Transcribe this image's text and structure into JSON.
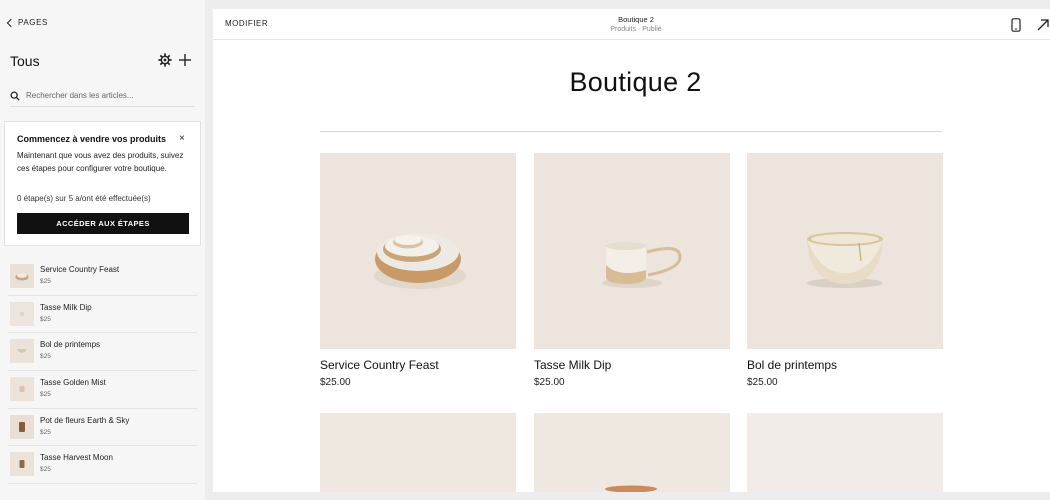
{
  "sidebar": {
    "back_label": "PAGES",
    "title": "Tous",
    "search_placeholder": "Rechercher dans les articles...",
    "promo": {
      "title": "Commencez à vendre vos produits",
      "close": "×",
      "body": "Maintenant que vous avez des produits, suivez ces étapes pour configurer votre boutique.",
      "progress": "0 étape(s) sur 5 a/ont été effectuée(s)",
      "button": "ACCÉDER AUX ÉTAPES"
    },
    "products": [
      {
        "name": "Service Country Feast",
        "price": "$25"
      },
      {
        "name": "Tasse Milk Dip",
        "price": "$25"
      },
      {
        "name": "Bol de printemps",
        "price": "$25"
      },
      {
        "name": "Tasse Golden Mist",
        "price": "$25"
      },
      {
        "name": "Pot de fleurs Earth & Sky",
        "price": "$25"
      },
      {
        "name": "Tasse Harvest Moon",
        "price": "$25"
      }
    ]
  },
  "topbar": {
    "modify": "MODIFIER",
    "title": "Boutique 2",
    "subtitle": "Produits · Publié"
  },
  "main": {
    "page_title": "Boutique 2",
    "cards": [
      {
        "name": "Service Country Feast",
        "price": "$25.00"
      },
      {
        "name": "Tasse Milk Dip",
        "price": "$25.00"
      },
      {
        "name": "Bol de printemps",
        "price": "$25.00"
      }
    ]
  },
  "icons": {
    "back": "chevron-left-icon",
    "gear": "gear-icon",
    "add": "plus-icon",
    "search": "search-icon",
    "close": "close-icon",
    "mobile": "mobile-device-icon",
    "open": "external-link-icon"
  },
  "colors": {
    "sidebar_bg": "#f6f6f6",
    "button_bg": "#111111",
    "product_bg": "#ede5dd"
  }
}
